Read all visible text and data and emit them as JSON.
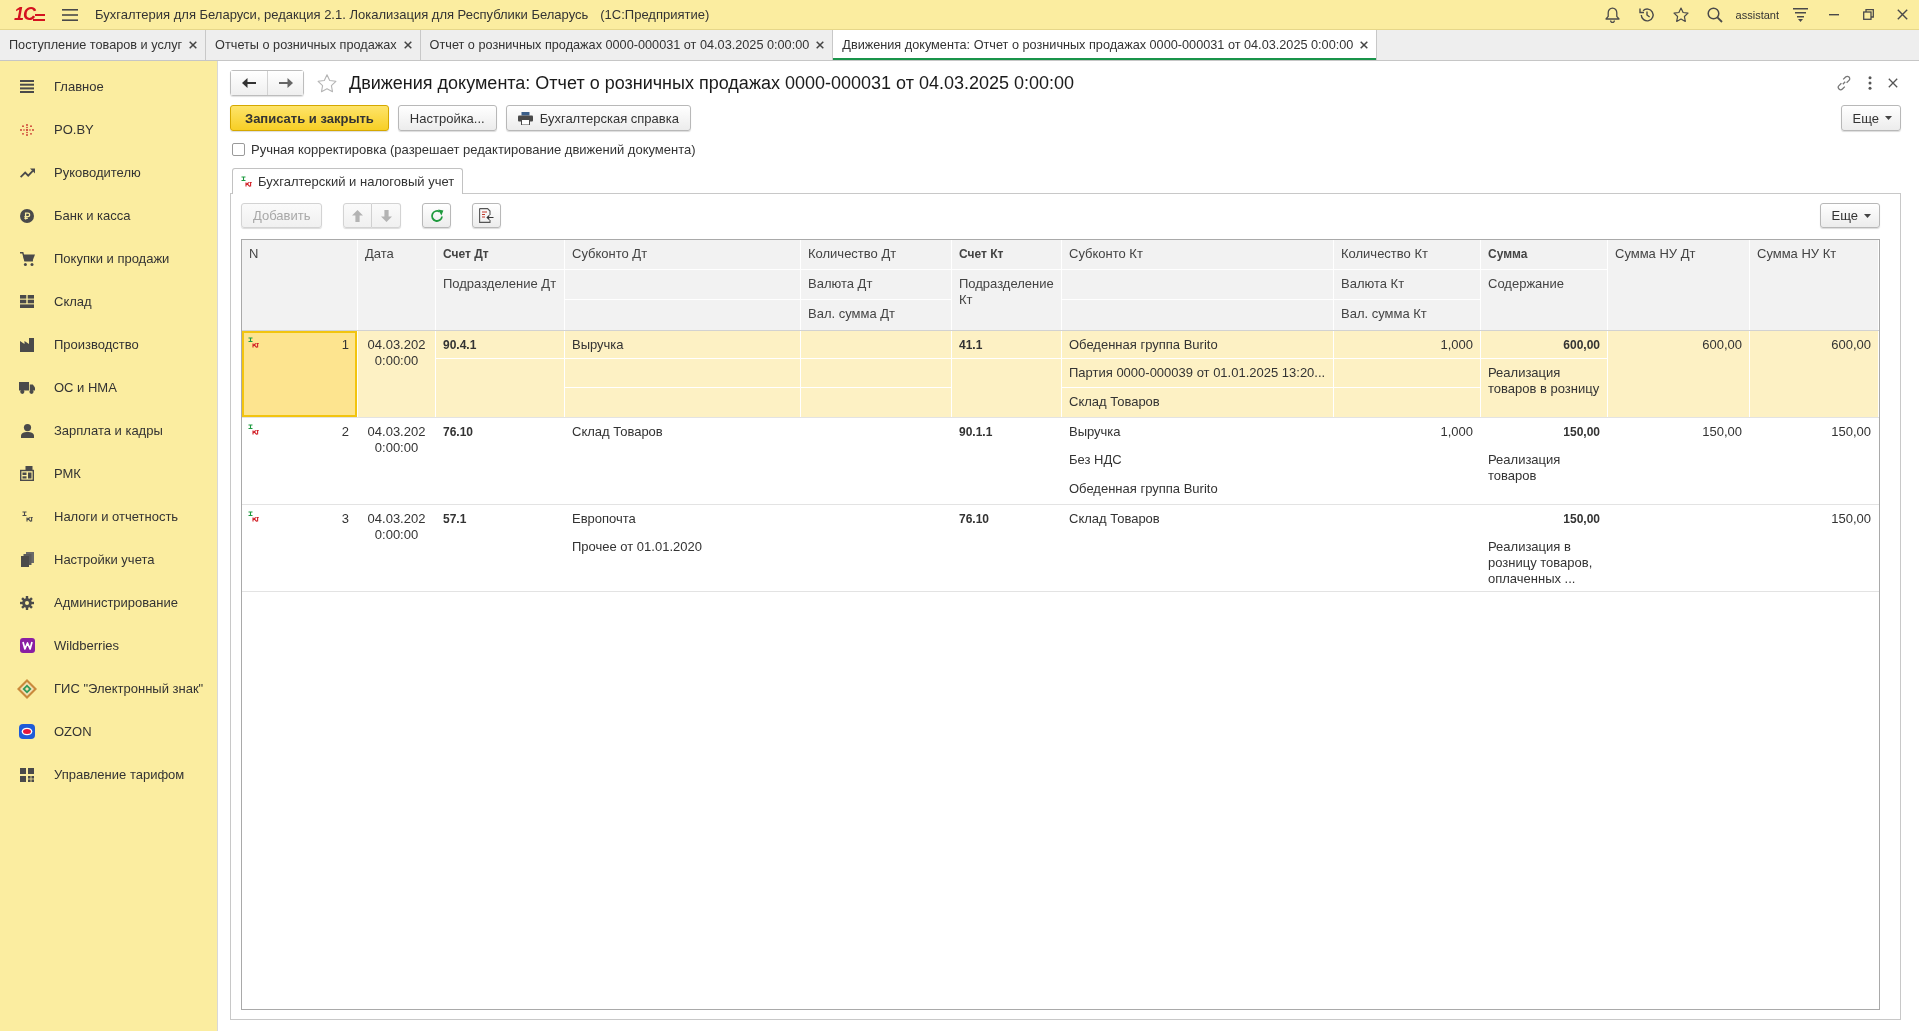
{
  "app": {
    "logo": "1С",
    "title": "Бухгалтерия для Беларуси, редакция 2.1. Локализация для Республики Беларусь",
    "platform": "(1С:Предприятие)",
    "user": "assistant"
  },
  "open_tabs": [
    {
      "label": "Поступление товаров и услуг",
      "selected": false
    },
    {
      "label": "Отчеты о розничных продажах",
      "selected": false
    },
    {
      "label": "Отчет о розничных продажах 0000-000031 от 04.03.2025 0:00:00",
      "selected": false
    },
    {
      "label": "Движения документа: Отчет о розничных продажах 0000-000031 от 04.03.2025 0:00:00",
      "selected": true
    }
  ],
  "sidebar": {
    "items": [
      {
        "label": "Главное"
      },
      {
        "label": "PO.BY"
      },
      {
        "label": "Руководителю"
      },
      {
        "label": "Банк и касса"
      },
      {
        "label": "Покупки и продажи"
      },
      {
        "label": "Склад"
      },
      {
        "label": "Производство"
      },
      {
        "label": "ОС и НМА"
      },
      {
        "label": "Зарплата и кадры"
      },
      {
        "label": "РМК"
      },
      {
        "label": "Налоги и отчетность"
      },
      {
        "label": "Настройки учета"
      },
      {
        "label": "Администрирование"
      },
      {
        "label": "Wildberries"
      },
      {
        "label": "ГИС \"Электронный знак\""
      },
      {
        "label": "OZON"
      },
      {
        "label": "Управление тарифом"
      }
    ]
  },
  "document": {
    "title": "Движения документа: Отчет о розничных продажах 0000-000031 от 04.03.2025 0:00:00",
    "buttons": [
      {
        "label": "Записать и закрыть",
        "kind": "primary"
      },
      {
        "label": "Настройка...",
        "kind": "plain"
      },
      {
        "label": "Бухгалтерская справка",
        "kind": "print"
      }
    ],
    "more_button": "Еще",
    "manual_edit": {
      "label": "Ручная корректировка (разрешает редактирование движений документа)",
      "checked": false
    },
    "tabs": [
      {
        "label": "Бухгалтерский и налоговый учет",
        "selected": true
      }
    ],
    "toolbar": {
      "add_button": {
        "label": "Добавить",
        "disabled": true
      },
      "move_buttons": {
        "disabled": true
      },
      "more_button": "Еще"
    },
    "table": {
      "columns": [
        {
          "kind": "single",
          "title": "N"
        },
        {
          "kind": "single",
          "title": "Дата"
        },
        {
          "kind": "split",
          "title": "Счет Дт",
          "subtitle": "Подразделение Дт"
        },
        {
          "kind": "triple",
          "title": "Субконто Дт"
        },
        {
          "kind": "triple",
          "title": "Количество Дт",
          "subtitles": [
            "Валюта Дт",
            "Вал. сумма Дт"
          ]
        },
        {
          "kind": "split",
          "title": "Счет Кт",
          "subtitle": "Подразделение Кт"
        },
        {
          "kind": "triple",
          "title": "Субконто Кт"
        },
        {
          "kind": "triple",
          "title": "Количество Кт",
          "subtitles": [
            "Валюта Кт",
            "Вал. сумма Кт"
          ]
        },
        {
          "kind": "split",
          "title": "Сумма",
          "subtitle": "Содержание"
        },
        {
          "kind": "single",
          "title": "Сумма НУ Дт"
        },
        {
          "kind": "single",
          "title": "Сумма НУ Кт"
        }
      ],
      "rows": [
        {
          "selected": true,
          "cells": [
            {
              "lines": [
                "1"
              ]
            },
            {
              "lines": [
                "04.03.202 0:00:00"
              ]
            },
            {
              "lines": [
                "90.4.1"
              ]
            },
            {
              "lines": [
                "Выручка"
              ]
            },
            {},
            {
              "lines": [
                "41.1"
              ]
            },
            {
              "lines": [
                "Обеденная группа Burito",
                "Партия 0000-000039 от 01.01.2025 13:20...",
                "Склад Товаров"
              ]
            },
            {
              "lines": [
                "1,000"
              ]
            },
            {
              "lines": [
                "600,00",
                "Реализация товаров в розницу"
              ]
            },
            {
              "lines": [
                "600,00"
              ]
            },
            {
              "lines": [
                "600,00"
              ]
            }
          ]
        },
        {
          "selected": false,
          "cells": [
            {
              "lines": [
                "2"
              ]
            },
            {
              "lines": [
                "04.03.202 0:00:00"
              ]
            },
            {
              "lines": [
                "76.10"
              ]
            },
            {
              "lines": [
                "Склад Товаров"
              ]
            },
            {},
            {
              "lines": [
                "90.1.1"
              ]
            },
            {
              "lines": [
                "Выручка",
                "Без НДС",
                "Обеденная группа Burito"
              ]
            },
            {
              "lines": [
                "1,000"
              ]
            },
            {
              "lines": [
                "150,00",
                "Реализация товаров"
              ]
            },
            {
              "lines": [
                "150,00"
              ]
            },
            {
              "lines": [
                "150,00"
              ]
            }
          ]
        },
        {
          "selected": false,
          "cells": [
            {
              "lines": [
                "3"
              ]
            },
            {
              "lines": [
                "04.03.202 0:00:00"
              ]
            },
            {
              "lines": [
                "57.1"
              ]
            },
            {
              "lines": [
                "Европочта",
                "Прочее от 01.01.2020"
              ]
            },
            {},
            {
              "lines": [
                "76.10"
              ]
            },
            {
              "lines": [
                "Склад Товаров"
              ]
            },
            {},
            {
              "lines": [
                "150,00",
                "Реализация в розницу товаров, оплаченных ..."
              ]
            },
            {},
            {
              "lines": [
                "150,00"
              ]
            }
          ]
        }
      ]
    }
  }
}
